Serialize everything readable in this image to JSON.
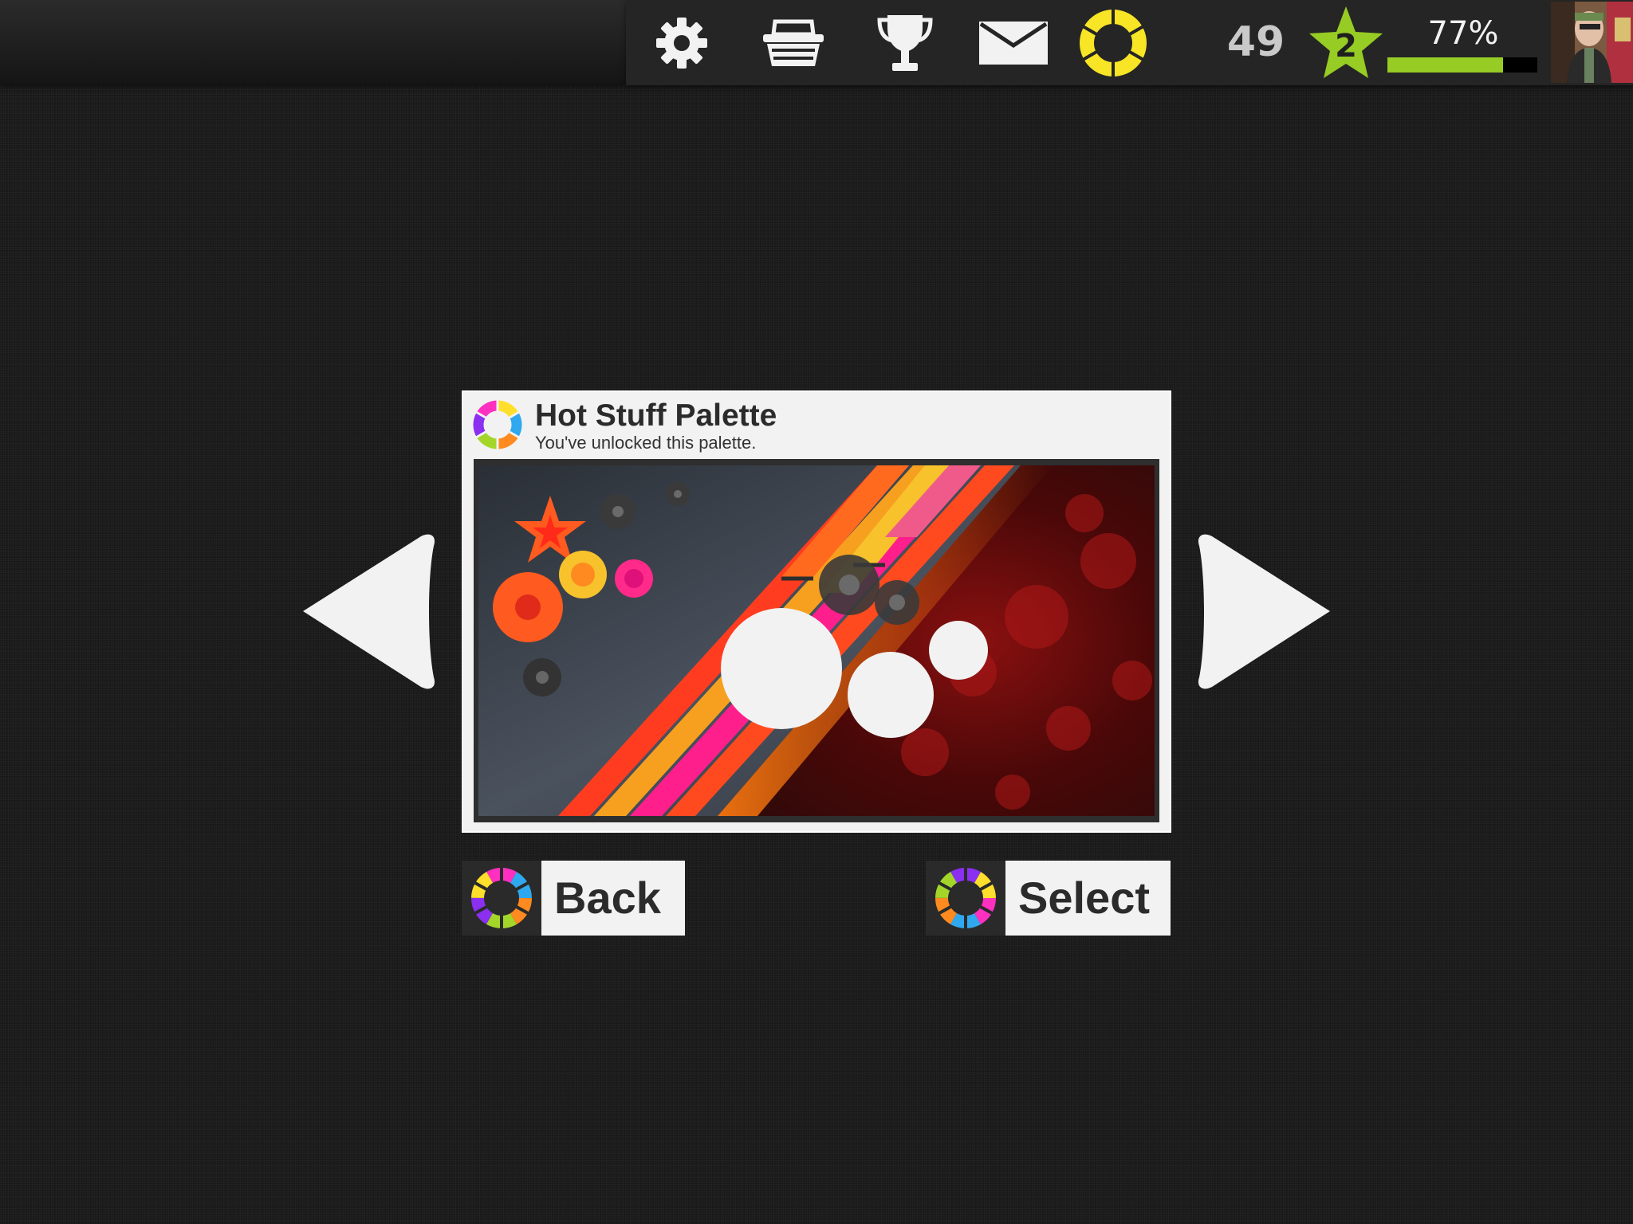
{
  "topbar": {
    "icons": [
      "gear-icon",
      "basket-icon",
      "trophy-icon",
      "mail-icon",
      "palette-ring-icon"
    ],
    "coins": "49",
    "level": "2",
    "xp_percent_label": "77%",
    "xp_fraction": 0.77,
    "accent_color": "#97cc24",
    "ring_color": "#f7e526"
  },
  "palette_card": {
    "title": "Hot Stuff Palette",
    "subtitle": "You've unlocked this palette.",
    "swatch_colors": [
      "#ff5a1f",
      "#f7c22b",
      "#ff1f8c",
      "#ff7a2a",
      "#f05a8a",
      "#ffffff"
    ]
  },
  "navigation": {
    "prev_icon": "arrow-left-icon",
    "next_icon": "arrow-right-icon"
  },
  "buttons": {
    "back_label": "Back",
    "select_label": "Select"
  }
}
